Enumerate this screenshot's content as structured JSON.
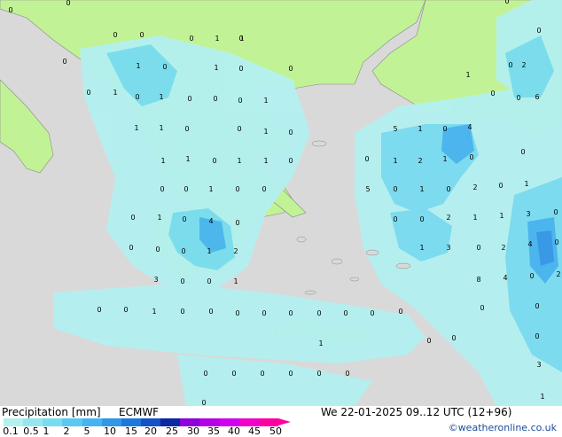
{
  "header": {
    "title": "Precipitation [mm]",
    "model": "ECMWF",
    "datetime": "We 22-01-2025 09..12 UTC (12+96)",
    "credit": "©weatheronline.co.uk"
  },
  "scale": {
    "labels": [
      "0.1",
      "0.5",
      "1",
      "2",
      "5",
      "10",
      "15",
      "20",
      "25",
      "30",
      "35",
      "40",
      "45",
      "50"
    ],
    "colors": [
      "#b4f0f0",
      "#96e6f0",
      "#78dcf0",
      "#5ac8f0",
      "#46b4f0",
      "#3296e6",
      "#1e78dc",
      "#1450c8",
      "#0a28a0",
      "#8c00dc",
      "#b400e6",
      "#d200f0",
      "#f000c8",
      "#ff00a0"
    ]
  },
  "map": {
    "colors": {
      "sea": "#d9d9d9",
      "land": "#c2f296",
      "precip_light": "#b4f0f0",
      "precip_medium": "#78dcf0",
      "precip_heavy": "#46b4f0",
      "precip_strong": "#3296e6"
    },
    "point_values": [
      "0",
      "0",
      "0",
      "0",
      "1",
      "0",
      "0",
      "1",
      "0",
      "1",
      "0",
      "1",
      "0",
      "0",
      "0",
      "1",
      "0",
      "1",
      "0",
      "0",
      "0",
      "1",
      "1",
      "1",
      "0",
      "0",
      "1",
      "0",
      "1",
      "1",
      "0",
      "1",
      "1",
      "0",
      "0",
      "0",
      "1",
      "0",
      "0",
      "0",
      "1",
      "0",
      "4",
      "0",
      "0",
      "0",
      "0",
      "1",
      "2",
      "3",
      "0",
      "0",
      "1",
      "0",
      "0",
      "1",
      "0",
      "0",
      "0",
      "0",
      "0",
      "0",
      "0",
      "0",
      "0",
      "0",
      "0",
      "1",
      "0",
      "0",
      "0",
      "0",
      "0",
      "0",
      "0",
      "0",
      "0",
      "0",
      "1",
      "2",
      "0",
      "0",
      "6",
      "5",
      "1",
      "0",
      "4",
      "0",
      "1",
      "2",
      "1",
      "0",
      "0",
      "5",
      "0",
      "1",
      "0",
      "2",
      "0",
      "1",
      "0",
      "0",
      "2",
      "1",
      "1",
      "3",
      "0",
      "1",
      "3",
      "0",
      "2",
      "4",
      "0",
      "8",
      "4",
      "0",
      "2",
      "0",
      "0",
      "0",
      "3",
      "1",
      "0",
      "3"
    ]
  }
}
